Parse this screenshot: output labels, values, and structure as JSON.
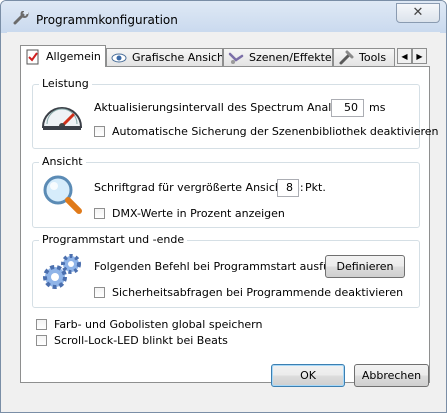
{
  "window": {
    "title": "Programmkonfiguration",
    "close_label": "✕"
  },
  "tabs": [
    {
      "label": "Allgemein",
      "icon": "checklist-icon"
    },
    {
      "label": "Grafische Ansicht",
      "icon": "eye-icon"
    },
    {
      "label": "Szenen/Effekte",
      "icon": "sliders-icon"
    },
    {
      "label": "Tools",
      "icon": "tools-icon"
    }
  ],
  "tab_scroll": {
    "left": "◀",
    "right": "▶"
  },
  "groups": {
    "leistung": {
      "title": "Leistung",
      "interval_label": "Aktualisierungsintervall des Spectrum Analyzers:",
      "interval_value": "50",
      "interval_unit": "ms",
      "autosave_label": "Automatische Sicherung der Szenenbibliothek deaktivieren"
    },
    "ansicht": {
      "title": "Ansicht",
      "font_label": "Schriftgrad für vergrößerte Ansichten:",
      "font_value": "8",
      "font_unit": "Pkt.",
      "dmx_label": "DMX-Werte in Prozent anzeigen"
    },
    "programmstart": {
      "title": "Programmstart und -ende",
      "command_label": "Folgenden Befehl bei Programmstart ausführen:",
      "define_button": "Definieren",
      "safety_label": "Sicherheitsabfragen bei Programmende deaktivieren"
    }
  },
  "options": {
    "colorlists_label": "Farb- und Gobolisten global speichern",
    "scrolllock_label": "Scroll-Lock-LED blinkt bei Beats"
  },
  "buttons": {
    "ok": "OK",
    "cancel": "Abbrechen"
  }
}
